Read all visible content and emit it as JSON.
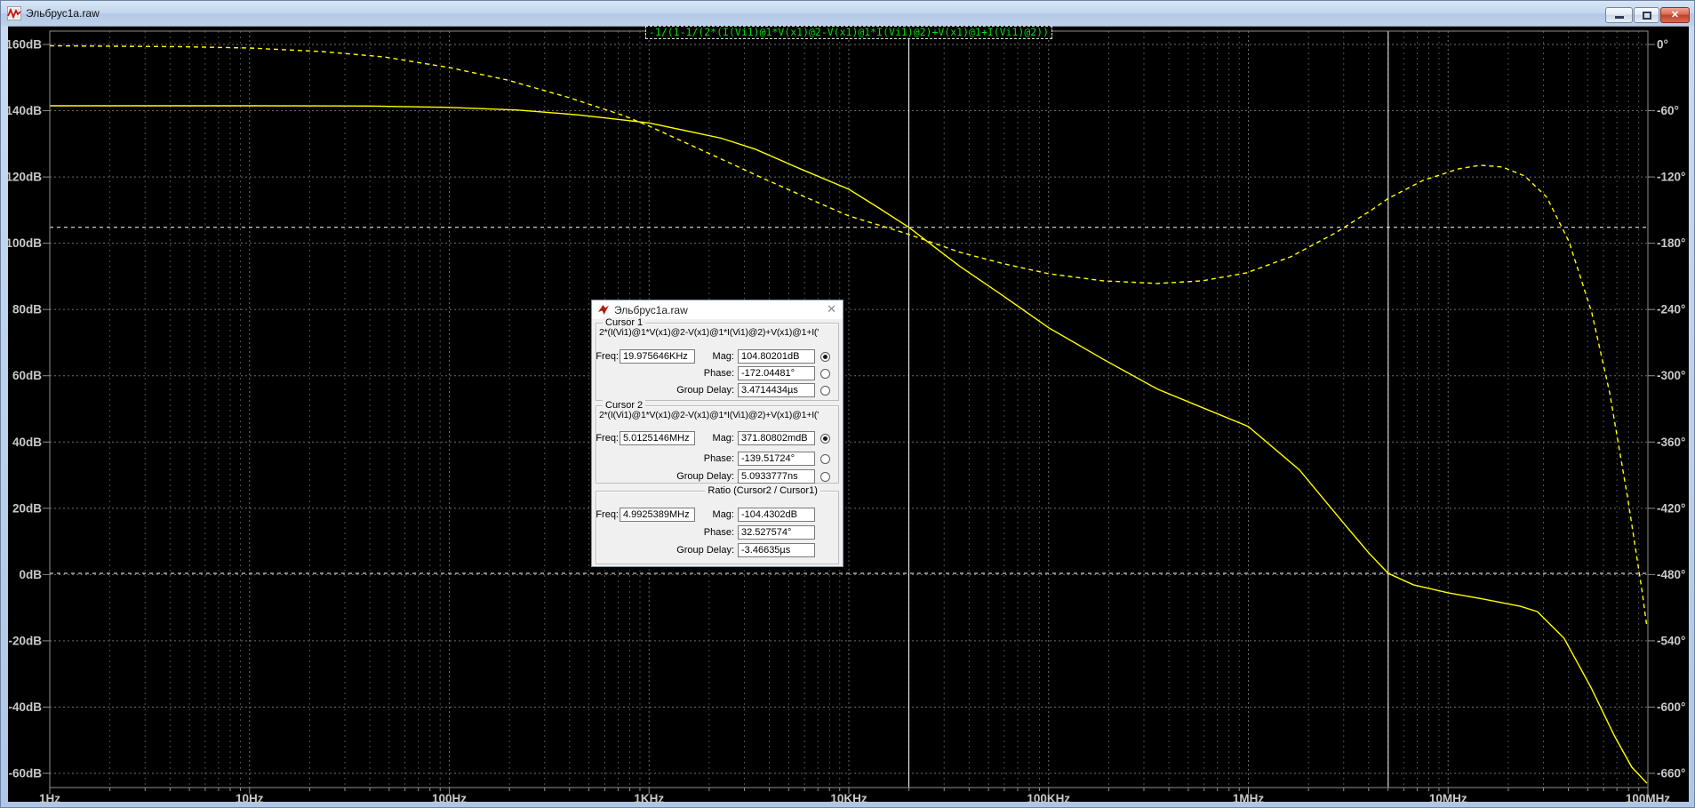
{
  "window": {
    "title": "Эльбрус1a.raw",
    "icon": "waveform-icon",
    "buttons": {
      "minimize": "minimize",
      "maximize": "maximize",
      "close": "close",
      "close_glyph": "x"
    }
  },
  "plot": {
    "expression_title": "-1/(1-1/(2*(I(Vi1)@1*V(x1)@2-V(x1)@1*I(Vi1)@2)+V(x1)@1+I(Vi1)@2))"
  },
  "chart_data": {
    "type": "line",
    "title": "-1/(1-1/(2*(I(Vi1)@1*V(x1)@2-V(x1)@1*I(Vi1)@2)+V(x1)@1+I(Vi1)@2))",
    "x_axis": {
      "scale": "log",
      "unit": "Hz",
      "min_hz": 1,
      "max_hz": 100000000,
      "tick_labels": [
        "1Hz",
        "10Hz",
        "100Hz",
        "1KHz",
        "10KHz",
        "100KHz",
        "1MHz",
        "10MHz",
        "100MHz"
      ]
    },
    "y_left_axis": {
      "label": "magnitude",
      "unit": "dB",
      "min": -60,
      "max": 160,
      "step": 20,
      "tick_labels": [
        "160dB",
        "140dB",
        "120dB",
        "100dB",
        "80dB",
        "60dB",
        "40dB",
        "20dB",
        "0dB",
        "-20dB",
        "-40dB",
        "-60dB"
      ]
    },
    "y_right_axis": {
      "label": "phase",
      "unit": "deg",
      "min": -660,
      "max": 0,
      "step": 60,
      "tick_labels": [
        "0°",
        "-60°",
        "-120°",
        "-180°",
        "-240°",
        "-300°",
        "-360°",
        "-420°",
        "-480°",
        "-540°",
        "-600°",
        "-660°"
      ]
    },
    "grid": true,
    "legend": "none",
    "series": [
      {
        "name": "magnitude",
        "axis": "left",
        "style": "solid",
        "color": "#ffff00",
        "points": [
          [
            1,
            141.5
          ],
          [
            10,
            141.5
          ],
          [
            40,
            141.4
          ],
          [
            100,
            141.0
          ],
          [
            220,
            140.2
          ],
          [
            450,
            138.7
          ],
          [
            1000,
            136.3
          ],
          [
            2300,
            131.7
          ],
          [
            3400,
            128.4
          ],
          [
            5700,
            122.5
          ],
          [
            10000,
            116.3
          ],
          [
            14000,
            110.8
          ],
          [
            19975,
            104.8
          ],
          [
            28000,
            98.0
          ],
          [
            36000,
            93.0
          ],
          [
            58000,
            84.5
          ],
          [
            100000,
            74.5
          ],
          [
            190000,
            64.8
          ],
          [
            350000,
            56.0
          ],
          [
            600000,
            50.2
          ],
          [
            1000000,
            44.7
          ],
          [
            1800000,
            31.6
          ],
          [
            3000000,
            15.5
          ],
          [
            4000000,
            6.6
          ],
          [
            5012515,
            0.37
          ],
          [
            6700000,
            -3.1
          ],
          [
            10000000,
            -5.5
          ],
          [
            15000000,
            -7.4
          ],
          [
            23000000,
            -9.6
          ],
          [
            28000000,
            -11.2
          ],
          [
            38000000,
            -19.2
          ],
          [
            52000000,
            -34.2
          ],
          [
            68000000,
            -48.7
          ],
          [
            83000000,
            -58.1
          ],
          [
            99000000,
            -63.0
          ]
        ]
      },
      {
        "name": "phase",
        "axis": "right",
        "style": "dashed",
        "color": "#ffff00",
        "points": [
          [
            1,
            -1.2
          ],
          [
            4.5,
            -2.0
          ],
          [
            10,
            -3.2
          ],
          [
            23,
            -6.4
          ],
          [
            47,
            -11.3
          ],
          [
            100,
            -20.9
          ],
          [
            195,
            -32.2
          ],
          [
            400,
            -48.3
          ],
          [
            745,
            -64.4
          ],
          [
            1000,
            -74.0
          ],
          [
            2060,
            -99.8
          ],
          [
            3830,
            -122.3
          ],
          [
            6380,
            -140.0
          ],
          [
            10000,
            -155.3
          ],
          [
            16000,
            -166.5
          ],
          [
            19975,
            -172.0
          ],
          [
            36000,
            -188.2
          ],
          [
            60000,
            -198.7
          ],
          [
            100000,
            -207.6
          ],
          [
            187000,
            -214.0
          ],
          [
            350000,
            -216.4
          ],
          [
            590000,
            -214.0
          ],
          [
            980000,
            -206.8
          ],
          [
            1630000,
            -192.3
          ],
          [
            2730000,
            -170.6
          ],
          [
            4100000,
            -150.4
          ],
          [
            5012515,
            -139.5
          ],
          [
            7500000,
            -123.1
          ],
          [
            11300000,
            -112.6
          ],
          [
            14500000,
            -109.4
          ],
          [
            18700000,
            -111.0
          ],
          [
            24200000,
            -119.1
          ],
          [
            31200000,
            -138.4
          ],
          [
            40300000,
            -178.6
          ],
          [
            52400000,
            -243.0
          ],
          [
            64400000,
            -315.4
          ],
          [
            79400000,
            -411.9
          ],
          [
            93000000,
            -492.0
          ],
          [
            99000000,
            -528.0
          ]
        ]
      }
    ],
    "cursors": [
      {
        "name": "cursor1",
        "freq_hz": 19975.646,
        "mag_db": 104.80201
      },
      {
        "name": "cursor2",
        "freq_hz": 5012514.6,
        "mag_db": 0.37180802
      }
    ]
  },
  "cursor_dialog": {
    "title": "Эльбрус1a.raw",
    "icon": "ltspice-logo-icon",
    "close_glyph": "✕",
    "expression": "2*(I(Vi1)@1*V(x1)@2-V(x1)@1*I(Vi1)@2)+V(x1)@1+I('",
    "labels": {
      "freq": "Freq:",
      "mag": "Mag:",
      "phase": "Phase:",
      "group_delay": "Group Delay:"
    },
    "cursor1": {
      "section": "Cursor 1",
      "freq": "19.975646KHz",
      "mag": "104.80201dB",
      "phase": "-172.04481°",
      "group_delay": "3.4714434µs",
      "selected": "mag"
    },
    "cursor2": {
      "section": "Cursor 2",
      "freq": "5.0125146MHz",
      "mag": "371.80802mdB",
      "phase": "-139.51724°",
      "group_delay": "5.0933777ns",
      "selected": "mag"
    },
    "ratio": {
      "section": "Ratio (Cursor2 / Cursor1)",
      "freq": "4.9925389MHz",
      "mag": "-104.4302dB",
      "phase": "32.527574°",
      "group_delay": "-3.46635µs"
    }
  }
}
